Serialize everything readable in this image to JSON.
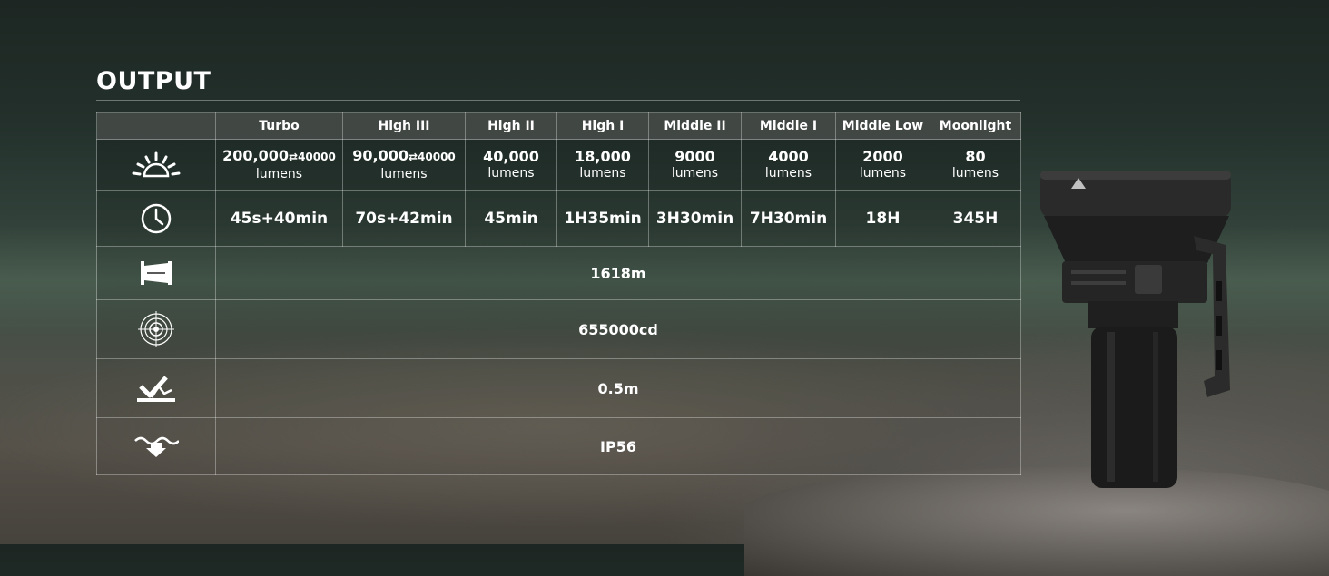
{
  "title": "OUTPUT",
  "modes": [
    "Turbo",
    "High III",
    "High II",
    "High I",
    "Middle II",
    "Middle I",
    "Middle Low",
    "Moonlight"
  ],
  "lumens": [
    {
      "value": "200,000",
      "note": "⇄40000",
      "unit": "lumens"
    },
    {
      "value": "90,000",
      "note": "⇄40000",
      "unit": "lumens"
    },
    {
      "value": "40,000",
      "note": "",
      "unit": "lumens"
    },
    {
      "value": "18,000",
      "note": "",
      "unit": "lumens"
    },
    {
      "value": "9000",
      "note": "",
      "unit": "lumens"
    },
    {
      "value": "4000",
      "note": "",
      "unit": "lumens"
    },
    {
      "value": "2000",
      "note": "",
      "unit": "lumens"
    },
    {
      "value": "80",
      "note": "",
      "unit": "lumens"
    }
  ],
  "runtimes": [
    "45s+40min",
    "70s+42min",
    "45min",
    "1H35min",
    "3H30min",
    "7H30min",
    "18H",
    "345H"
  ],
  "distance": "1618m",
  "intensity": "655000cd",
  "impact": "0.5m",
  "waterproof": "IP56",
  "icons": {
    "lumens": "light-burst-icon",
    "runtime": "clock-icon",
    "distance": "beam-distance-icon",
    "intensity": "target-intensity-icon",
    "impact": "impact-resistance-icon",
    "waterproof": "water-resistance-icon"
  }
}
